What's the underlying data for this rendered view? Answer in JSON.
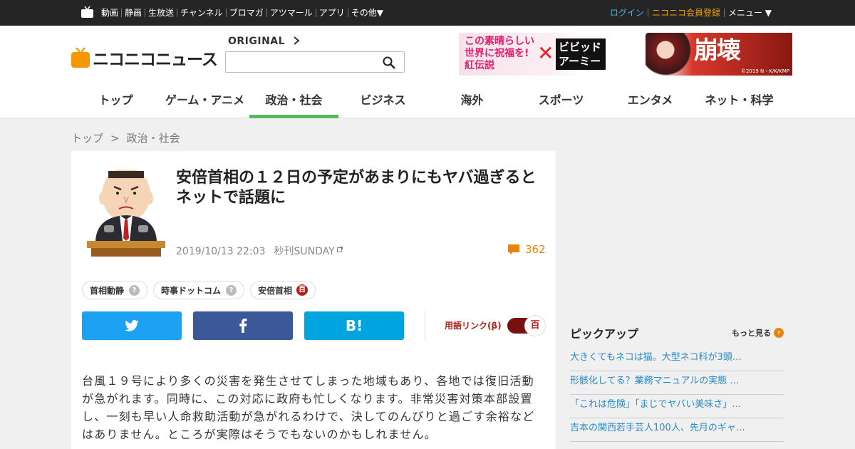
{
  "topbar": {
    "links": [
      "動画",
      "静画",
      "生放送",
      "チャンネル",
      "ブロマガ",
      "アツマール",
      "アプリ",
      "その他▼"
    ],
    "login": "ログイン",
    "register": "ニコニコ会員登録",
    "menu": "メニュー ▼"
  },
  "header": {
    "logo": "ニコニコニュース",
    "original_label": "ORIGINAL",
    "search": {
      "value": "",
      "placeholder": ""
    },
    "banner": {
      "left_text": "この素晴らしい世界に祝福を!紅伝説",
      "x": "✕",
      "middle_text": "ビビッドアーミー",
      "right_text": "崩壊",
      "copyright": "©2019 N・K/K/KMP"
    }
  },
  "nav": {
    "items": [
      "トップ",
      "ゲーム・アニメ",
      "政治・社会",
      "ビジネス",
      "海外",
      "スポーツ",
      "エンタメ",
      "ネット・科学"
    ],
    "active_index": 2
  },
  "breadcrumb": {
    "home": "トップ",
    "sep": ">",
    "current": "政治・社会"
  },
  "article": {
    "title": "安倍首相の１２日の予定があまりにもヤバ過ぎるとネットで話題に",
    "date": "2019/10/13 22:03",
    "source": "秒刊SUNDAY",
    "comment_count": "362",
    "tags": [
      {
        "label": "首相動静",
        "badge": "?"
      },
      {
        "label": "時事ドットコム",
        "badge": "?"
      },
      {
        "label": "安倍首相",
        "badge": "百"
      }
    ],
    "share": {
      "hatena": "B!"
    },
    "yogo_link": "用語リンク(β)",
    "toggle_icon": "百",
    "body": "台風１９号により多くの災害を発生させてしまった地域もあり、各地では復旧活動が急がれます。同時に、この対応に政府も忙しくなります。非常災害対策本部設置し、一刻も早い人命救助活動が急がれるわけで、決してのんびりと過ごす余裕などはありません。ところが実際はそうでもないのかもしれません。"
  },
  "pickup": {
    "title": "ピックアップ",
    "more": "もっと見る",
    "items": [
      "大きくてもネコは猫。大型ネコ科が3頭…",
      "形骸化してる？業務マニュアルの実態 …",
      "「これは危険」「まじでヤバい美味さ」…",
      "吉本の関西若手芸人100人、先月のギャ…"
    ]
  },
  "colors": {
    "topbar_bg": "#252525",
    "accent_green": "#5cb85c",
    "comment_orange": "#e8830f",
    "twitter": "#1da1f2",
    "facebook": "#3b5998",
    "hatena": "#00a4de",
    "dic_red": "#b0231d"
  },
  "icons": [
    "tv-icon",
    "search-icon",
    "comment-icon",
    "twitter-icon",
    "facebook-icon",
    "external-link-icon",
    "arrow-right-icon"
  ]
}
